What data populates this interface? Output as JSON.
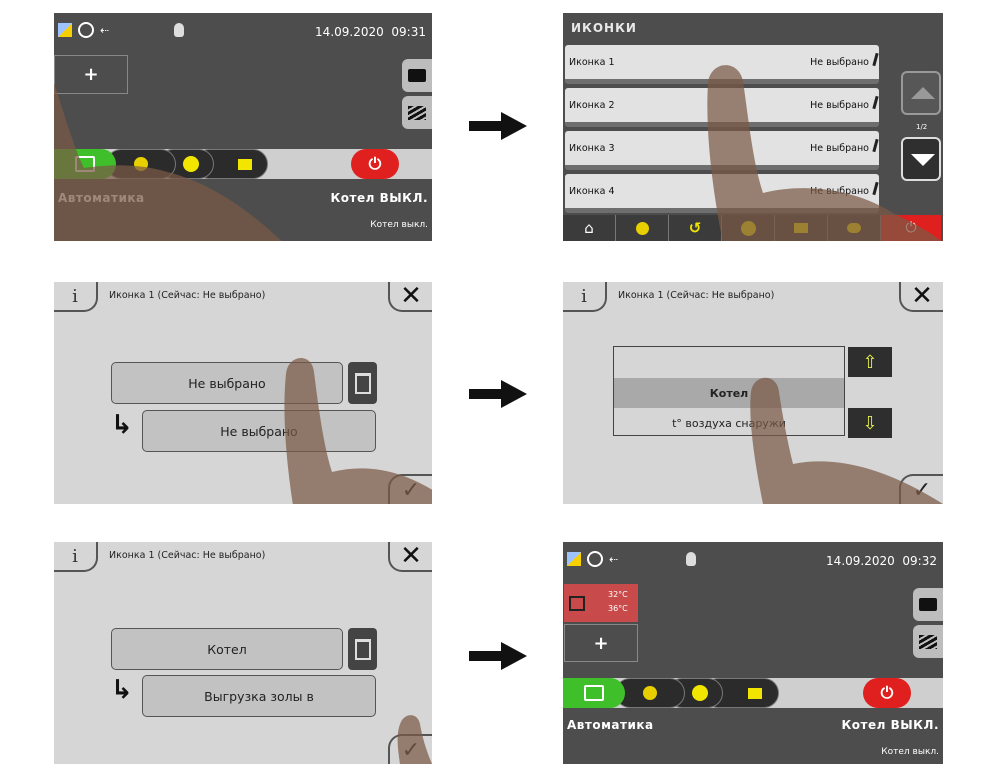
{
  "home1": {
    "date": "14.09.2020",
    "time": "09:31",
    "mode_label": "Автоматика",
    "status_label": "Котел ВЫКЛ.",
    "status_sub": "Котел выкл."
  },
  "icons_list": {
    "title": "ИКОНКИ",
    "rows": [
      {
        "name": "Иконка 1",
        "value": "Не выбрано"
      },
      {
        "name": "Иконка 2",
        "value": "Не выбрано"
      },
      {
        "name": "Иконка 3",
        "value": "Не выбрано"
      },
      {
        "name": "Иконка 4",
        "value": "Не выбрано"
      }
    ],
    "page": "1/2"
  },
  "dialog1": {
    "title": "Иконка  1 (Сейчас: Не выбрано)",
    "field_top": "Не выбрано",
    "field_bottom": "Не выбрано"
  },
  "dialog2": {
    "title": "Иконка  1 (Сейчас: Не выбрано)",
    "option_selected": "Котел",
    "option_next": "t° воздуха снаружи"
  },
  "dialog3": {
    "title": "Иконка  1 (Сейчас: Не выбрано)",
    "field_top": "Котел",
    "field_bottom": "Выгрузка золы в"
  },
  "home2": {
    "date": "14.09.2020",
    "time": "09:32",
    "temp1": "32°C",
    "temp2": "36°C",
    "mode_label": "Автоматика",
    "status_label": "Котел ВЫКЛ.",
    "status_sub": "Котел выкл."
  },
  "colors": {
    "dark_bg": "#4d4d4d",
    "light_bg": "#d6d6d6",
    "power_red": "#e0201e",
    "auto_green": "#3fbf2a",
    "tile_red": "#c94a4a",
    "info_yellow": "#f2e600"
  }
}
